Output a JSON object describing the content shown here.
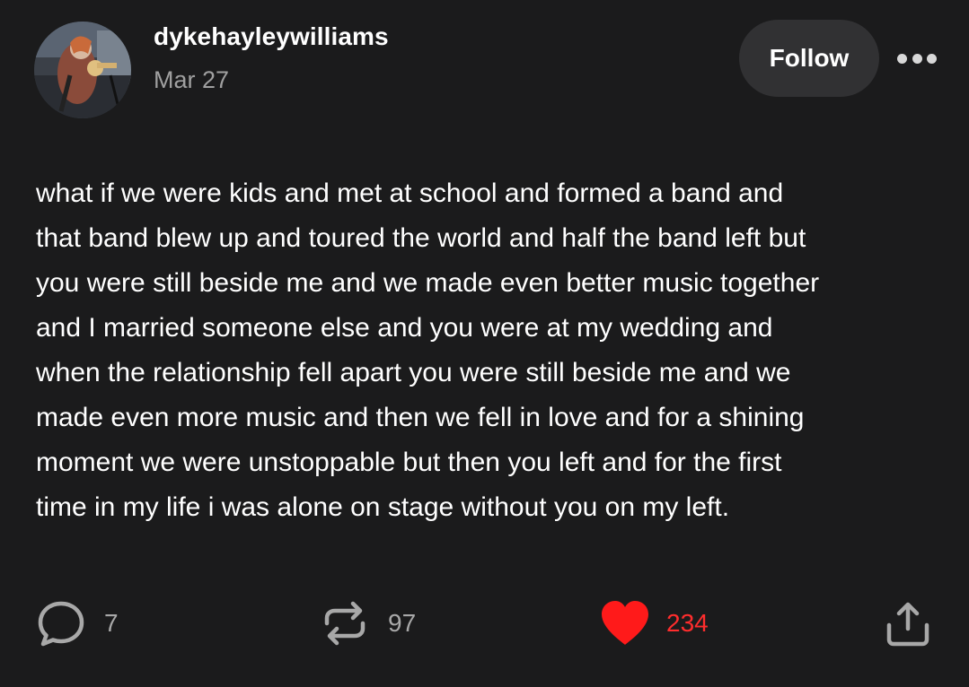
{
  "author": {
    "username": "dykehayleywilliams",
    "date": "Mar 27"
  },
  "header": {
    "follow_label": "Follow",
    "more_icon": "more-options-icon"
  },
  "post": {
    "lines": [
      "what if we were kids and met at school and formed a band and",
      "that band blew up and toured the world and half the band left but",
      "you were still beside me and we made even better music together",
      "and I married someone else and you were at my wedding and",
      "when the relationship fell apart you were still beside me and we",
      "made even more music and then we fell in love and for a shining",
      "moment we were unstoppable but then you left and for the first",
      "time in my life i was alone on stage without you on my left."
    ]
  },
  "actions": {
    "replies": "7",
    "reblogs": "97",
    "likes": "234",
    "reply_icon": "speech-bubble-icon",
    "reblog_icon": "repost-arrows-icon",
    "like_icon": "heart-icon",
    "share_icon": "share-upload-icon"
  },
  "colors": {
    "background": "#1b1b1c",
    "button_bg": "#313133",
    "muted_text": "#a0a0a0",
    "like_red": "#ff2d2d"
  }
}
